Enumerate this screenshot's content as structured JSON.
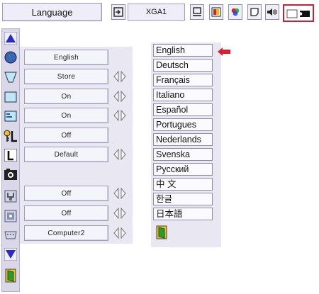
{
  "menu": {
    "title": "Language",
    "input_source": "XGA1"
  },
  "colors": {
    "accent_red": "#c8203a",
    "panel_bg": "#e8e7f2",
    "field_border": "#9e9cb6",
    "icon_blue": "#2a2ac8"
  },
  "toolbar_icons": [
    "input-icon",
    "monitor-icon",
    "color-adjust-icon",
    "color-palette-icon",
    "screen-icon",
    "volume-icon",
    "projector-setting-icon"
  ],
  "left_icons": [
    "scroll-up-icon",
    "globe-icon",
    "keystone-icon",
    "blue-back-icon",
    "display-icon",
    "logo-lock-icon",
    "logo-icon",
    "capture-icon",
    "power-management-icon",
    "remote-control-icon",
    "terminal-icon",
    "scroll-down-icon",
    "exit-icon"
  ],
  "settings": [
    {
      "value": "English",
      "arrows": false
    },
    {
      "value": "Store",
      "arrows": true
    },
    {
      "value": "On",
      "arrows": true
    },
    {
      "value": "On",
      "arrows": true
    },
    {
      "value": "Off",
      "arrows": false
    },
    {
      "value": "Default",
      "arrows": true
    },
    {
      "value": "Off",
      "arrows": true
    },
    {
      "value": "Off",
      "arrows": true
    },
    {
      "value": "Computer2",
      "arrows": true
    }
  ],
  "languages": [
    "English",
    "Deutsch",
    "Français",
    "Italiano",
    "Español",
    "Portugues",
    "Nederlands",
    "Svenska",
    "Русский",
    "中 文",
    "한글",
    "日本語"
  ],
  "selected_language": "English"
}
